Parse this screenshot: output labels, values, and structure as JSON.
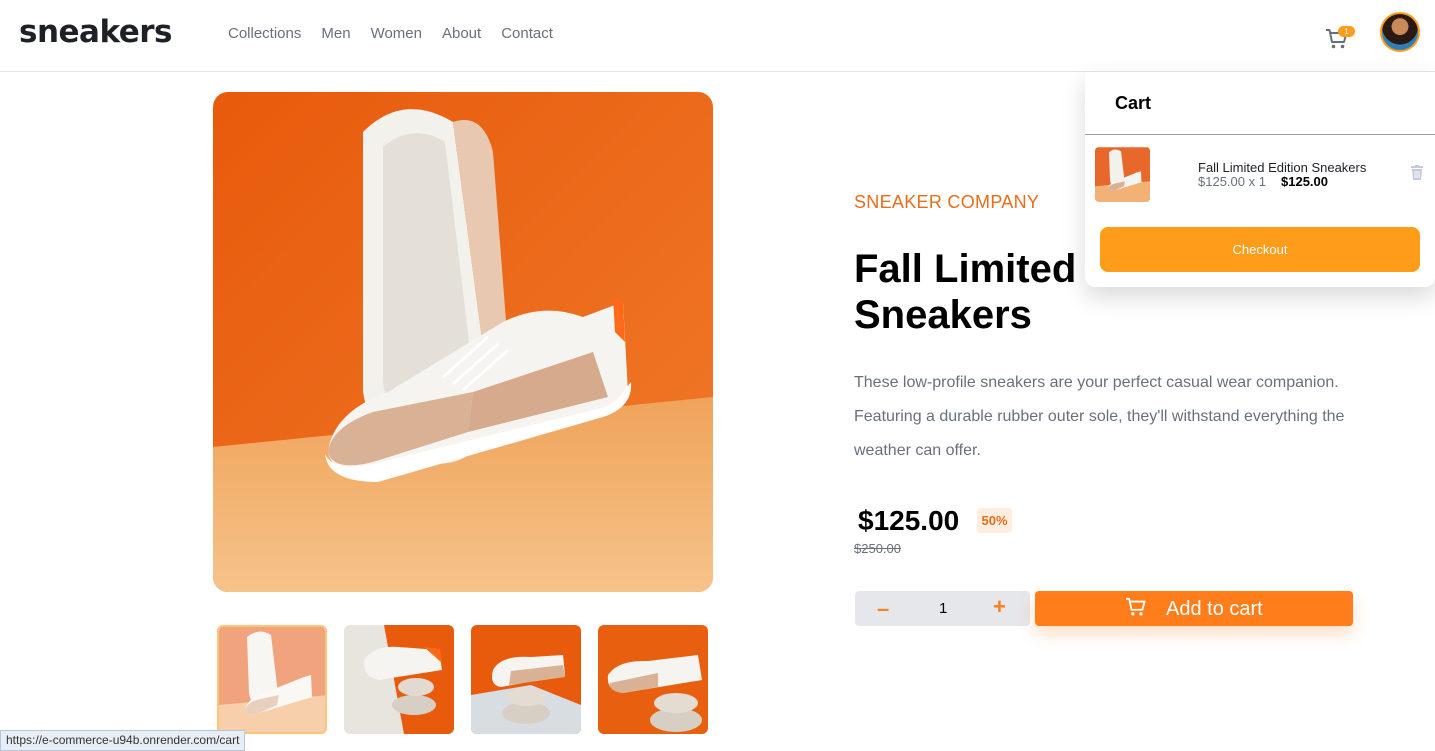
{
  "header": {
    "logo": "sneakers",
    "nav": [
      "Collections",
      "Men",
      "Women",
      "About",
      "Contact"
    ],
    "cart_count": "1",
    "avatar_icon": "user-avatar",
    "cart_icon": "cart-icon"
  },
  "product": {
    "company": "SNEAKER COMPANY",
    "title": "Fall Limited Edition Sneakers",
    "description": "These low-profile sneakers are your perfect casual wear companion. Featuring a durable rubber outer sole, they'll withstand everything the weather can offer.",
    "price": "$125.00",
    "discount": "50%",
    "old_price": "$250.00",
    "quantity": "1",
    "minus_label": "–",
    "plus_label": "+",
    "add_to_cart": "Add to cart"
  },
  "cart": {
    "title": "Cart",
    "item_name": "Fall Limited Edition Sneakers",
    "item_calc": "$125.00 x 1",
    "item_total": "$125.00",
    "checkout_label": "Checkout"
  },
  "status_bar": {
    "url": "https://e-commerce-u94b.onrender.com/cart"
  },
  "colors": {
    "accent": "#ff7d1a",
    "accent_light": "#ff9c1a",
    "company_text": "#e96d1a",
    "discount_bg": "#ffede0"
  }
}
